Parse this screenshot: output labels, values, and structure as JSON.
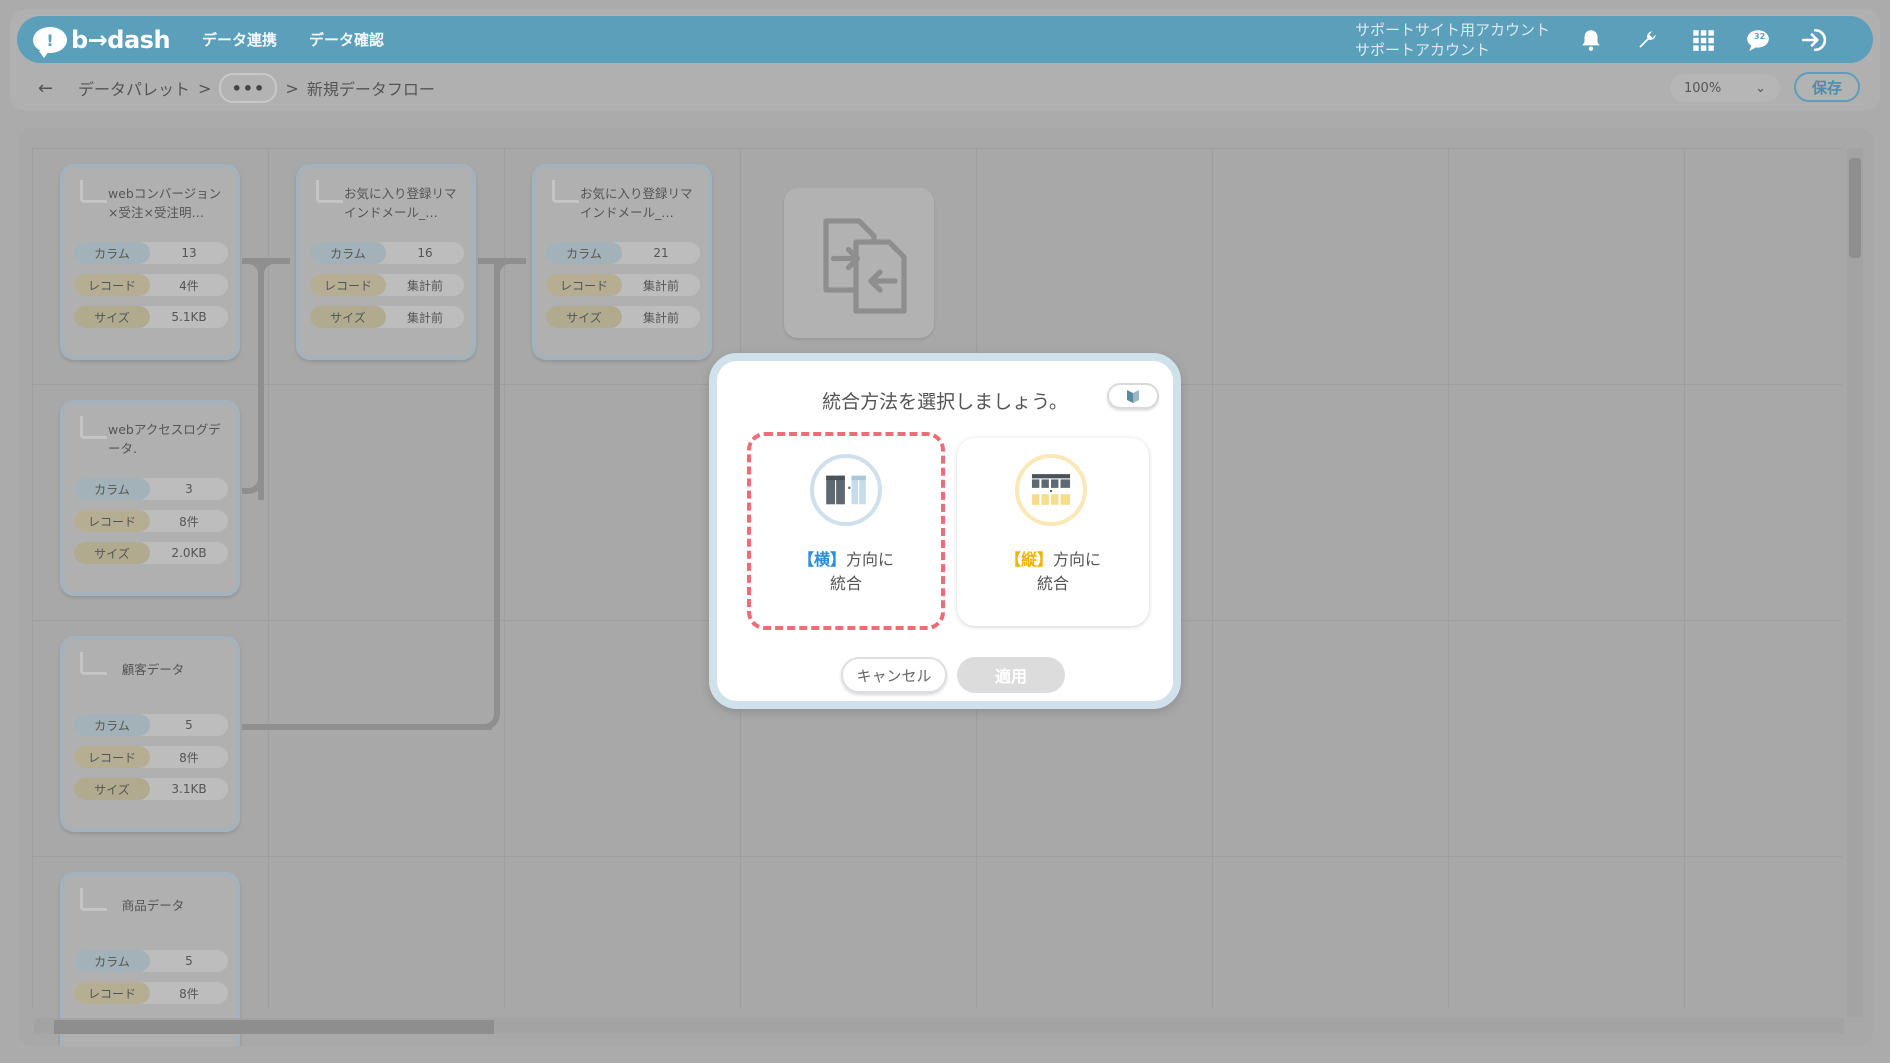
{
  "header": {
    "logo_text": "b→dash",
    "logo_mark": "!",
    "nav": [
      "データ連携",
      "データ確認"
    ],
    "account_line1": "サポートサイト用アカウント",
    "account_line2": "サポートアカウント",
    "notification_count": "32"
  },
  "breadcrumb": {
    "back": "←",
    "root": "データパレット",
    "sep": ">",
    "more": "•••",
    "current": "新規データフロー"
  },
  "toolbar": {
    "zoom": "100%",
    "zoom_chevron": "⌄",
    "save_label": "保存"
  },
  "canvas": {
    "nodes": [
      {
        "title": "webコンバージョン×受注×受注明…",
        "stats": [
          [
            "カラム",
            "13"
          ],
          [
            "レコード",
            "4件"
          ],
          [
            "サイズ",
            "5.1KB"
          ]
        ]
      },
      {
        "title": "お気に入り登録リマインドメール_…",
        "stats": [
          [
            "カラム",
            "16"
          ],
          [
            "レコード",
            "集計前"
          ],
          [
            "サイズ",
            "集計前"
          ]
        ]
      },
      {
        "title": "お気に入り登録リマインドメール_…",
        "stats": [
          [
            "カラム",
            "21"
          ],
          [
            "レコード",
            "集計前"
          ],
          [
            "サイズ",
            "集計前"
          ]
        ]
      },
      {
        "title": "webアクセスログデータ.",
        "stats": [
          [
            "カラム",
            "3"
          ],
          [
            "レコード",
            "8件"
          ],
          [
            "サイズ",
            "2.0KB"
          ]
        ]
      },
      {
        "title": "顧客データ",
        "stats": [
          [
            "カラム",
            "5"
          ],
          [
            "レコード",
            "8件"
          ],
          [
            "サイズ",
            "3.1KB"
          ]
        ]
      },
      {
        "title": "商品データ",
        "stats": [
          [
            "カラム",
            "5"
          ],
          [
            "レコード",
            "8件"
          ]
        ]
      }
    ]
  },
  "modal": {
    "title": "統合方法を選択しましょう。",
    "options": {
      "horizontal": {
        "bracket": "【横】",
        "line1": "方向に",
        "line2": "統合"
      },
      "vertical": {
        "bracket": "【縦】",
        "line1": "方向に",
        "line2": "統合"
      }
    },
    "cancel_label": "キャンセル",
    "apply_label": "適用"
  },
  "colors": {
    "brand": "#5b9fba",
    "selected_dash": "#ec6d76",
    "horizontal_accent": "#2a8fd6",
    "vertical_accent": "#f0b400"
  }
}
